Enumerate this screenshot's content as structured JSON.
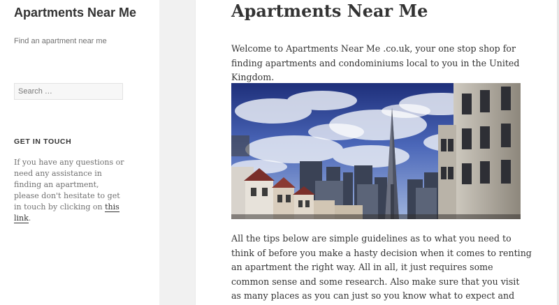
{
  "site": {
    "title": "Apartments Near Me",
    "description": "Find an apartment near me"
  },
  "search": {
    "placeholder": "Search …"
  },
  "widget": {
    "title": "GET IN TOUCH",
    "text_before": "If you have any questions or need any assistance in finding an apartment, please don't hesitate to get in touch by clicking on ",
    "link_text": "this link",
    "text_after": "."
  },
  "post": {
    "title": "Apartments Near Me",
    "intro": "Welcome to Apartments Near Me .co.uk, your one stop shop for finding apartments and condominiums local to you in the United Kingdom.",
    "body": "All the tips below are simple guidelines as to what you need to think of before you make a hasty decision when it comes to renting an apartment the right way. All in all, it just requires some common sense and some research. Also make sure that you visit as many places as you can just so you know what to expect and have a variety of choices to choose from;"
  },
  "colors": {
    "sidebar_bg": "#ffffff",
    "page_bg": "#f1f1f1",
    "text": "#333333",
    "muted": "#707070"
  }
}
